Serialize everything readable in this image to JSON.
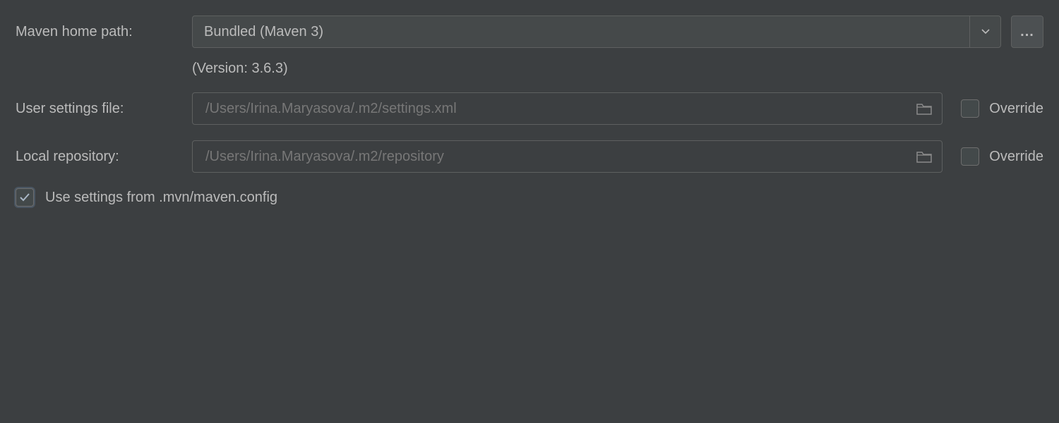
{
  "labels": {
    "maven_home_path": "Maven home path:",
    "user_settings_file": "User settings file:",
    "local_repository": "Local repository:",
    "override": "Override",
    "use_mvn_config": "Use settings from .mvn/maven.config"
  },
  "maven_home": {
    "selected": "Bundled (Maven 3)",
    "version_text": "(Version: 3.6.3)",
    "browse_label": "..."
  },
  "user_settings": {
    "value": "/Users/Irina.Maryasova/.m2/settings.xml",
    "override_checked": false
  },
  "local_repo": {
    "value": "/Users/Irina.Maryasova/.m2/repository",
    "override_checked": false
  },
  "use_mvn_config_checked": true
}
